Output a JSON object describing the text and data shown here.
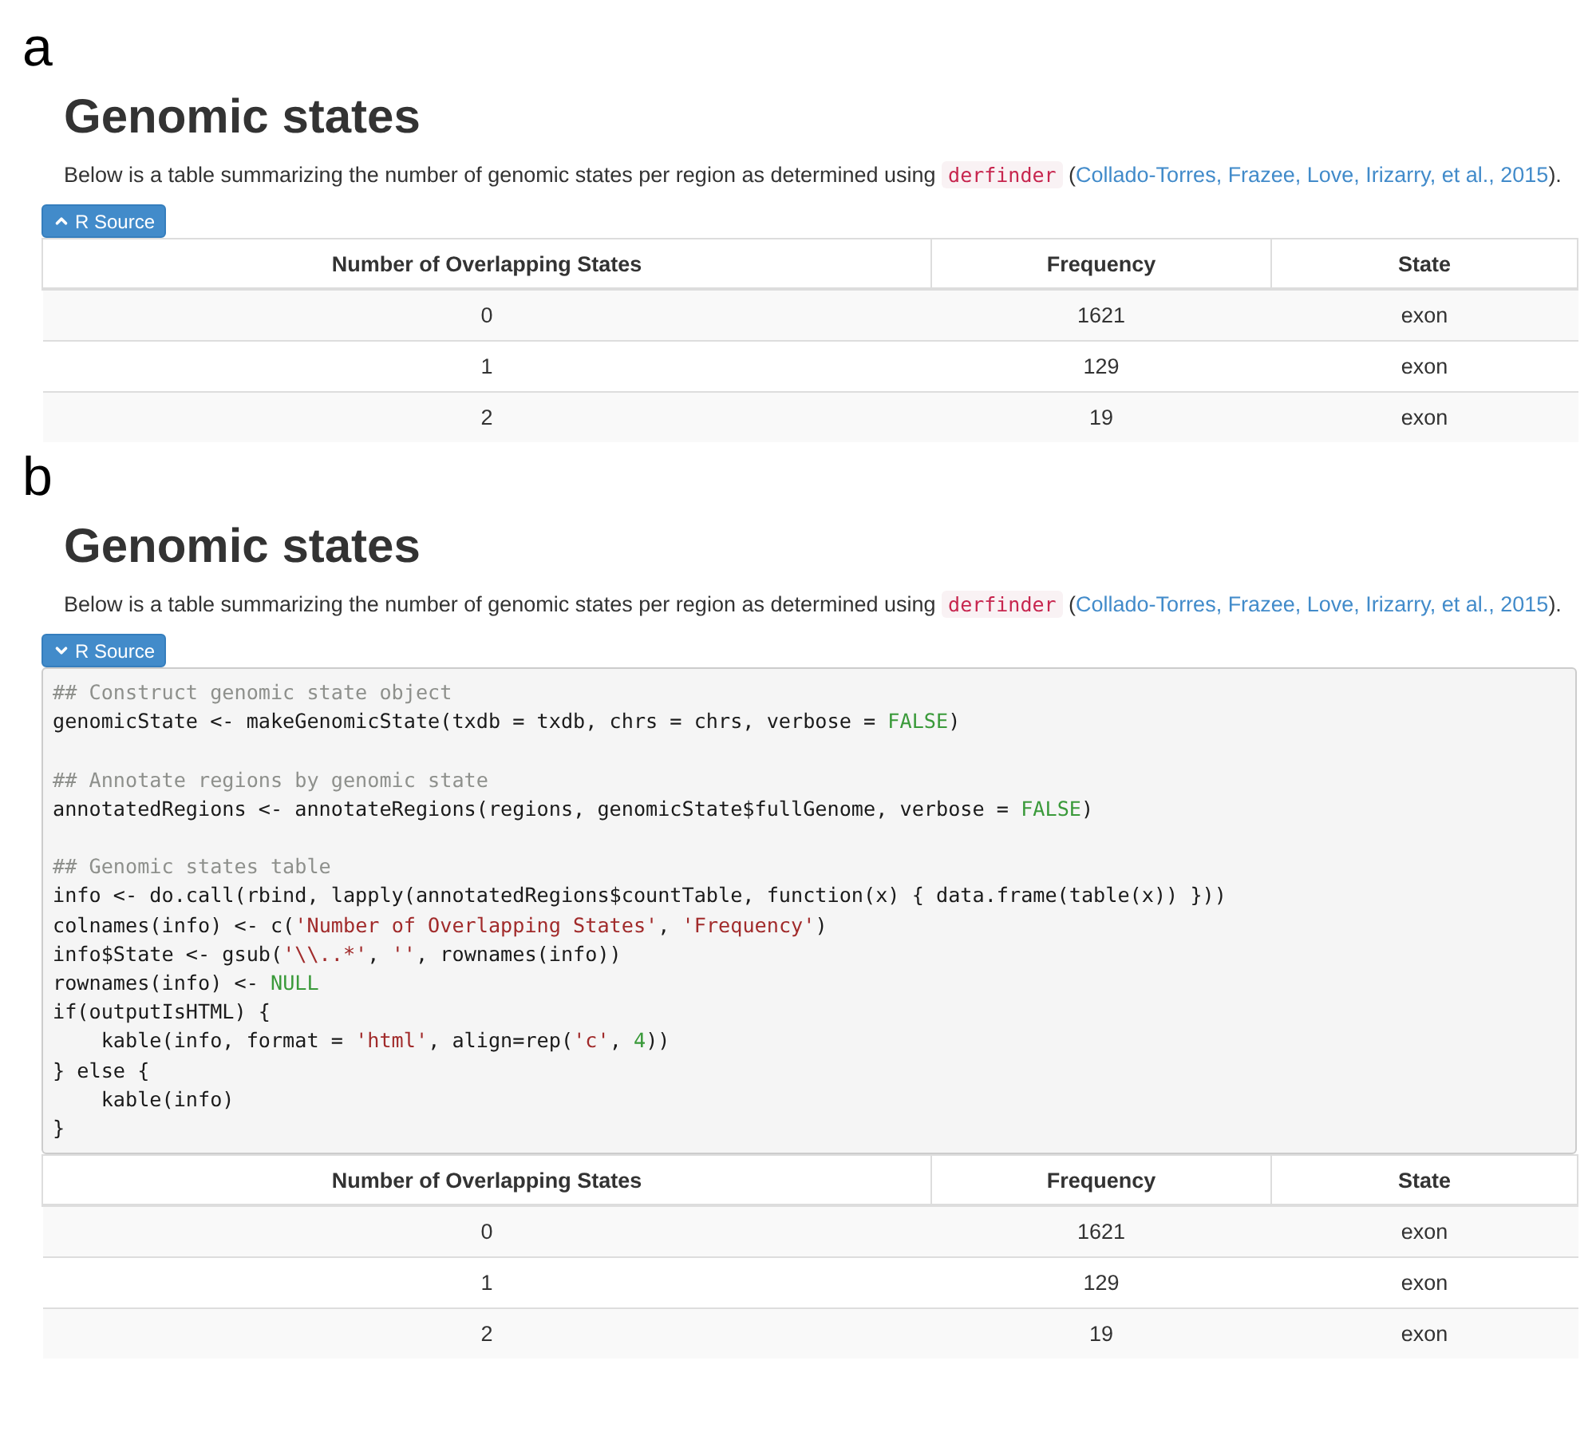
{
  "panels": [
    {
      "label": "a",
      "heading": "Genomic states",
      "intro": {
        "before": "Below is a table summarizing the number of genomic states per region as determined using ",
        "package": "derfinder",
        "open": " (",
        "links": [
          "Collado-Torres, Frazee, Love, Irizarry, et al.,",
          "2015"
        ],
        "close": ")."
      },
      "source_button": {
        "label": "R Source",
        "expanded": false
      },
      "table": {
        "columns": [
          "Number of Overlapping States",
          "Frequency",
          "State"
        ],
        "rows": [
          [
            "0",
            "1621",
            "exon"
          ],
          [
            "1",
            "129",
            "exon"
          ],
          [
            "2",
            "19",
            "exon"
          ]
        ]
      }
    },
    {
      "label": "b",
      "heading": "Genomic states",
      "intro": {
        "before": "Below is a table summarizing the number of genomic states per region as determined using ",
        "package": "derfinder",
        "open": " (",
        "links": [
          "Collado-Torres, Frazee, Love, Irizarry, et al.,",
          "2015"
        ],
        "close": ")."
      },
      "source_button": {
        "label": "R Source",
        "expanded": true
      },
      "code": [
        {
          "kind": "line",
          "segments": [
            {
              "kind": "comment",
              "text": "## Construct genomic state object"
            }
          ]
        },
        {
          "kind": "line",
          "segments": [
            {
              "kind": "plain",
              "text": "genomicState <- makeGenomicState(txdb = txdb, chrs = chrs, verbose = "
            },
            {
              "kind": "literal",
              "text": "FALSE"
            },
            {
              "kind": "plain",
              "text": ")"
            }
          ]
        },
        {
          "kind": "blank"
        },
        {
          "kind": "line",
          "segments": [
            {
              "kind": "comment",
              "text": "## Annotate regions by genomic state"
            }
          ]
        },
        {
          "kind": "line",
          "segments": [
            {
              "kind": "plain",
              "text": "annotatedRegions <- annotateRegions(regions, genomicState$fullGenome, verbose = "
            },
            {
              "kind": "literal",
              "text": "FALSE"
            },
            {
              "kind": "plain",
              "text": ")"
            }
          ]
        },
        {
          "kind": "blank"
        },
        {
          "kind": "line",
          "segments": [
            {
              "kind": "comment",
              "text": "## Genomic states table"
            }
          ]
        },
        {
          "kind": "line",
          "segments": [
            {
              "kind": "plain",
              "text": "info <- do.call(rbind, lapply(annotatedRegions$countTable, function(x) { data.frame(table(x)) }))"
            }
          ]
        },
        {
          "kind": "line",
          "segments": [
            {
              "kind": "plain",
              "text": "colnames(info) <- c("
            },
            {
              "kind": "string",
              "text": "'Number of Overlapping States'"
            },
            {
              "kind": "plain",
              "text": ", "
            },
            {
              "kind": "string",
              "text": "'Frequency'"
            },
            {
              "kind": "plain",
              "text": ")"
            }
          ]
        },
        {
          "kind": "line",
          "segments": [
            {
              "kind": "plain",
              "text": "info$State <- gsub("
            },
            {
              "kind": "string",
              "text": "'\\\\..*'"
            },
            {
              "kind": "plain",
              "text": ", "
            },
            {
              "kind": "string",
              "text": "''"
            },
            {
              "kind": "plain",
              "text": ", rownames(info))"
            }
          ]
        },
        {
          "kind": "line",
          "segments": [
            {
              "kind": "plain",
              "text": "rownames(info) <- "
            },
            {
              "kind": "literal",
              "text": "NULL"
            }
          ]
        },
        {
          "kind": "line",
          "segments": [
            {
              "kind": "plain",
              "text": "if(outputIsHTML) {"
            }
          ]
        },
        {
          "kind": "line",
          "segments": [
            {
              "kind": "plain",
              "text": "    kable(info, format = "
            },
            {
              "kind": "string",
              "text": "'html'"
            },
            {
              "kind": "plain",
              "text": ", align=rep("
            },
            {
              "kind": "string",
              "text": "'c'"
            },
            {
              "kind": "plain",
              "text": ", "
            },
            {
              "kind": "literal",
              "text": "4"
            },
            {
              "kind": "plain",
              "text": "))"
            }
          ]
        },
        {
          "kind": "line",
          "segments": [
            {
              "kind": "plain",
              "text": "} else {"
            }
          ]
        },
        {
          "kind": "line",
          "segments": [
            {
              "kind": "plain",
              "text": "    kable(info)"
            }
          ]
        },
        {
          "kind": "line",
          "segments": [
            {
              "kind": "plain",
              "text": "}"
            }
          ]
        }
      ],
      "table": {
        "columns": [
          "Number of Overlapping States",
          "Frequency",
          "State"
        ],
        "rows": [
          [
            "0",
            "1621",
            "exon"
          ],
          [
            "1",
            "129",
            "exon"
          ],
          [
            "2",
            "19",
            "exon"
          ]
        ]
      }
    }
  ]
}
